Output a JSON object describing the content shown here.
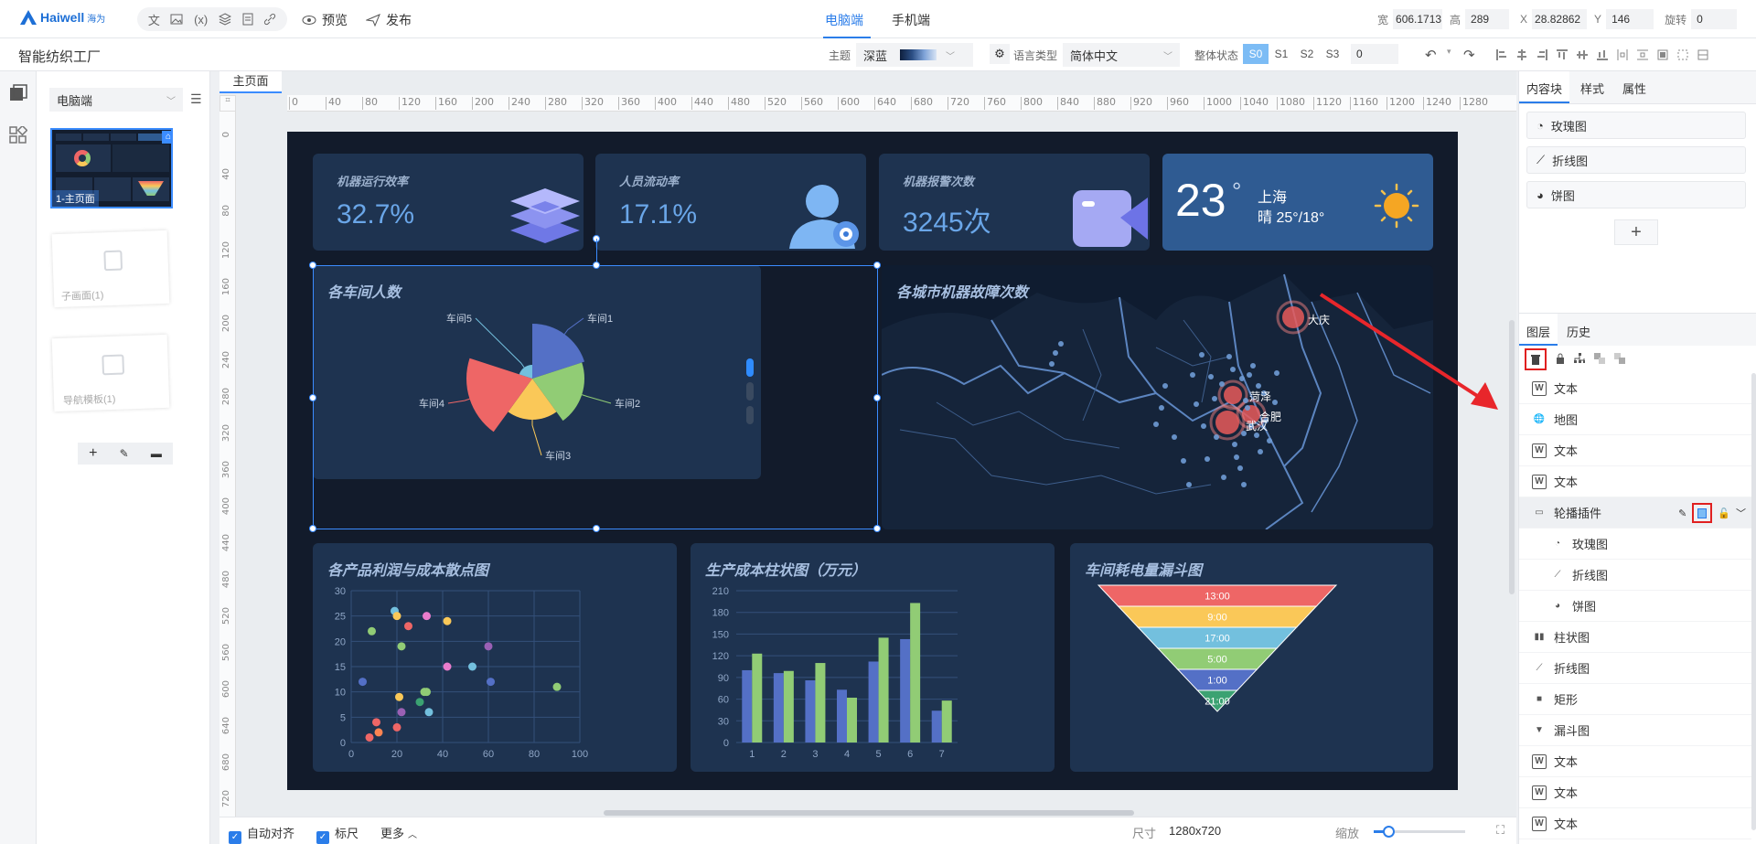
{
  "brand": {
    "name": "Haiwell",
    "cn": "海为"
  },
  "top": {
    "preview": "预览",
    "publish": "发布",
    "tabs": [
      "电脑端",
      "手机端"
    ],
    "props": {
      "w_label": "宽",
      "w": "606.1713",
      "h_label": "高",
      "h": "289",
      "x_label": "X",
      "x": "28.82862",
      "y_label": "Y",
      "y": "146",
      "rot_label": "旋转",
      "rot": "0"
    }
  },
  "project": {
    "name": "智能纺织工厂"
  },
  "toolbar": {
    "theme_label": "主题",
    "theme": "深蓝",
    "lang_label": "语言类型",
    "lang": "简体中文",
    "state_label": "整体状态",
    "states": [
      "S0",
      "S1",
      "S2",
      "S3"
    ],
    "state_value": "0"
  },
  "pages": {
    "device": "电脑端",
    "tab": "主页面",
    "items": [
      {
        "label": "1-主页面"
      },
      {
        "label": "子画面(1)"
      },
      {
        "label": "导航模板(1)"
      }
    ]
  },
  "ruler": {
    "h": [
      "0",
      "40",
      "80",
      "120",
      "160",
      "200",
      "240",
      "280",
      "320",
      "360",
      "400",
      "440",
      "480",
      "520",
      "560",
      "600",
      "640",
      "680",
      "720",
      "760",
      "800",
      "840",
      "880",
      "920",
      "960",
      "1000",
      "1040",
      "1080",
      "1120",
      "1160",
      "1200",
      "1240",
      "1280"
    ],
    "v": [
      "0",
      "40",
      "80",
      "120",
      "160",
      "200",
      "240",
      "280",
      "320",
      "360",
      "400",
      "440",
      "480",
      "520",
      "560",
      "600",
      "640",
      "680",
      "720"
    ]
  },
  "kpis": [
    {
      "label": "机器运行效率",
      "value": "32.7%"
    },
    {
      "label": "人员流动率",
      "value": "17.1%"
    },
    {
      "label": "机器报警次数",
      "value": "3245次"
    }
  ],
  "weather": {
    "temp": "23",
    "deg": "°",
    "city": "上海",
    "desc": "晴 25°/18°"
  },
  "panels": {
    "pie": "各车间人数",
    "map": "各城市机器故障次数",
    "scatter": "各产品利润与成本散点图",
    "bar": "生产成本柱状图（万元）",
    "funnel": "车间耗电量漏斗图"
  },
  "map_cities": [
    "大庆",
    "菏泽",
    "合肥",
    "武汉"
  ],
  "colors": {
    "accent": "#2b7de9",
    "dash_bg": "#121b2b",
    "card": "#1e3350",
    "weather": "#2f5b92"
  },
  "chart_data": [
    {
      "type": "pie",
      "variant": "rose",
      "title": "各车间人数",
      "categories": [
        "车间1",
        "车间2",
        "车间3",
        "车间4",
        "车间5"
      ],
      "values": [
        100,
        95,
        75,
        120,
        25
      ],
      "colors": [
        "#5470c6",
        "#91cc75",
        "#fac858",
        "#ee6666",
        "#73c0de"
      ]
    },
    {
      "type": "scatter",
      "title": "各产品利润与成本散点图",
      "xlim": [
        0,
        100
      ],
      "ylim": [
        0,
        30
      ],
      "xticks": [
        "0",
        "20",
        "40",
        "60",
        "80",
        "100"
      ],
      "yticks": [
        "0",
        "5",
        "10",
        "15",
        "20",
        "25",
        "30"
      ],
      "grid": true,
      "points": [
        [
          5,
          12
        ],
        [
          8,
          1
        ],
        [
          9,
          22
        ],
        [
          11,
          4
        ],
        [
          12,
          2
        ],
        [
          19,
          26
        ],
        [
          20,
          25
        ],
        [
          20,
          3
        ],
        [
          21,
          9
        ],
        [
          22,
          6
        ],
        [
          22,
          19
        ],
        [
          25,
          23
        ],
        [
          30,
          8
        ],
        [
          32,
          10
        ],
        [
          33,
          10
        ],
        [
          33,
          25
        ],
        [
          34,
          6
        ],
        [
          42,
          24
        ],
        [
          42,
          15
        ],
        [
          53,
          15
        ],
        [
          60,
          19
        ],
        [
          61,
          12
        ],
        [
          90,
          11
        ]
      ],
      "colors": [
        "#5470c6",
        "#ee6666",
        "#91cc75",
        "#ee6666",
        "#fc8452",
        "#73c0de",
        "#fac858",
        "#ee6666",
        "#fac858",
        "#9a60b4",
        "#91cc75",
        "#ee6666",
        "#3ba272",
        "#91cc75",
        "#91cc75",
        "#ea7ccc",
        "#73c0de",
        "#fac858",
        "#ea7ccc",
        "#73c0de",
        "#9a60b4",
        "#5470c6",
        "#91cc75"
      ]
    },
    {
      "type": "bar",
      "title": "生产成本柱状图（万元）",
      "categories": [
        "1",
        "2",
        "3",
        "4",
        "5",
        "6",
        "7"
      ],
      "ylim": [
        0,
        210
      ],
      "yticks": [
        "0",
        "30",
        "60",
        "90",
        "120",
        "150",
        "180",
        "210"
      ],
      "grid": true,
      "series": [
        {
          "values": [
            100,
            96,
            86,
            73,
            112,
            143,
            44
          ],
          "color": "#5470c6"
        },
        {
          "values": [
            123,
            99,
            110,
            62,
            145,
            193,
            58
          ],
          "color": "#91cc75"
        }
      ]
    },
    {
      "type": "funnel",
      "title": "车间耗电量漏斗图",
      "categories": [
        "13:00",
        "9:00",
        "17:00",
        "5:00",
        "1:00",
        "21:00"
      ],
      "colors": [
        "#ee6666",
        "#fac858",
        "#73c0de",
        "#91cc75",
        "#5470c6",
        "#3ba272"
      ]
    }
  ],
  "right": {
    "tabs": [
      "内容块",
      "样式",
      "属性"
    ],
    "content_blocks": [
      "玫瑰图",
      "折线图",
      "饼图"
    ],
    "layer_tabs": [
      "图层",
      "历史"
    ],
    "layers": [
      {
        "label": "文本",
        "icon": "w"
      },
      {
        "label": "地图",
        "icon": "globe"
      },
      {
        "label": "文本",
        "icon": "w"
      },
      {
        "label": "文本",
        "icon": "w"
      },
      {
        "label": "轮播插件",
        "icon": "carousel",
        "selected": true
      },
      {
        "label": "玫瑰图",
        "icon": "rose",
        "child": true
      },
      {
        "label": "折线图",
        "icon": "line",
        "child": true
      },
      {
        "label": "饼图",
        "icon": "pie",
        "child": true
      },
      {
        "label": "柱状图",
        "icon": "bar"
      },
      {
        "label": "折线图",
        "icon": "line"
      },
      {
        "label": "矩形",
        "icon": "rect"
      },
      {
        "label": "漏斗图",
        "icon": "funnel"
      },
      {
        "label": "文本",
        "icon": "w"
      },
      {
        "label": "文本",
        "icon": "w"
      },
      {
        "label": "文本",
        "icon": "w"
      }
    ]
  },
  "bottom": {
    "auto_align": "自动对齐",
    "ruler": "标尺",
    "more": "更多",
    "size_label": "尺寸",
    "size": "1280x720",
    "zoom_label": "缩放"
  }
}
